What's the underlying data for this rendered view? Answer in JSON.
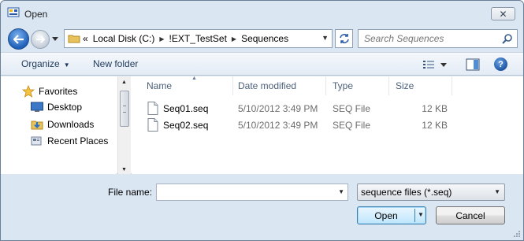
{
  "window": {
    "title": "Open"
  },
  "address": {
    "crumbs": [
      {
        "label": "«"
      },
      {
        "label": "Local Disk (C:)"
      },
      {
        "label": "!EXT_TestSet"
      },
      {
        "label": "Sequences"
      }
    ]
  },
  "search": {
    "placeholder": "Search Sequences"
  },
  "toolbar": {
    "organize_label": "Organize",
    "new_folder_label": "New folder"
  },
  "nav": {
    "favorites_label": "Favorites",
    "items": [
      {
        "label": "Desktop"
      },
      {
        "label": "Downloads"
      },
      {
        "label": "Recent Places"
      }
    ]
  },
  "columns": {
    "name": "Name",
    "date": "Date modified",
    "type": "Type",
    "size": "Size"
  },
  "files": [
    {
      "name": "Seq01.seq",
      "date": "5/10/2012 3:49 PM",
      "type": "SEQ File",
      "size": "12 KB"
    },
    {
      "name": "Seq02.seq",
      "date": "5/10/2012 3:49 PM",
      "type": "SEQ File",
      "size": "12 KB"
    }
  ],
  "bottom": {
    "file_name_label": "File name:",
    "file_name_value": "",
    "filter_value": "sequence files (*.seq)",
    "open_label": "Open",
    "cancel_label": "Cancel"
  },
  "colors": {
    "accent": "#1e5fb8",
    "frame": "#dbe6f3",
    "link_text": "#1e395b"
  }
}
